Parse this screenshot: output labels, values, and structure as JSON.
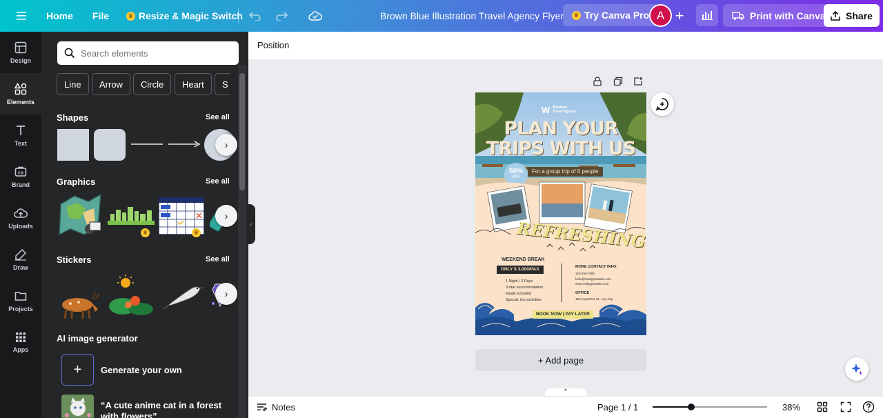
{
  "topbar": {
    "home": "Home",
    "file": "File",
    "resize": "Resize & Magic Switch",
    "title": "Brown Blue Illustration Travel Agency Flyer",
    "try_pro": "Try Canva Pro",
    "avatar_letter": "A",
    "print": "Print with Canva",
    "share": "Share"
  },
  "rail": {
    "items": [
      {
        "label": "Design",
        "icon": "design-icon"
      },
      {
        "label": "Elements",
        "icon": "elements-icon",
        "active": true
      },
      {
        "label": "Text",
        "icon": "text-icon"
      },
      {
        "label": "Brand",
        "icon": "brand-icon"
      },
      {
        "label": "Uploads",
        "icon": "uploads-icon"
      },
      {
        "label": "Draw",
        "icon": "draw-icon"
      },
      {
        "label": "Projects",
        "icon": "projects-icon"
      },
      {
        "label": "Apps",
        "icon": "apps-icon"
      }
    ]
  },
  "panel": {
    "search_placeholder": "Search elements",
    "chips": [
      "Line",
      "Arrow",
      "Circle",
      "Heart",
      "S"
    ],
    "shapes_title": "Shapes",
    "graphics_title": "Graphics",
    "stickers_title": "Stickers",
    "see_all": "See all",
    "ai_title": "AI image generator",
    "generate": "Generate your own",
    "prompt_line1": "“A cute anime cat in a forest",
    "prompt_line2": "with flowers”"
  },
  "editor": {
    "position": "Position",
    "add_page": "+ Add page",
    "notes": "Notes",
    "page_indicator": "Page 1 / 1",
    "zoom": "38%",
    "zoom_fraction": 0.34
  },
  "flyer": {
    "brand_line1": "Wardiere",
    "brand_line2": "Travel Agency",
    "headline1": "PLAN YOUR",
    "headline2": "TRIPS WITH US",
    "discount": "50%",
    "discount_sub": "OFF",
    "group_text": "For a group trip of 5 people",
    "script": "REFRESHING",
    "weekend": "WEEKEND BREAK",
    "price": "ONLY $ 3,000/PAX",
    "bullets": [
      "1 Night / 2 Days",
      "3-star accommodation",
      "Meals included",
      "Special, fun activities"
    ],
    "contact_title": "MORE CONTACT INFO:",
    "contact_lines": [
      "123-456-7890",
      "hello@reallygreatsite.com",
      "www.reallygreatsite.com"
    ],
    "office_title": "OFFICE",
    "office_line": "123 Anywhere St., Any City",
    "cta": "BOOK NOW | PAY LATER"
  },
  "colors": {
    "accent_purple": "#7d2ae8",
    "teal": "#00c4cc",
    "panel_bg": "#252627",
    "flyer_bg": "#fbe2c9",
    "flyer_yellow": "#f2e6a0",
    "wave_blue": "#2a5fa8"
  }
}
